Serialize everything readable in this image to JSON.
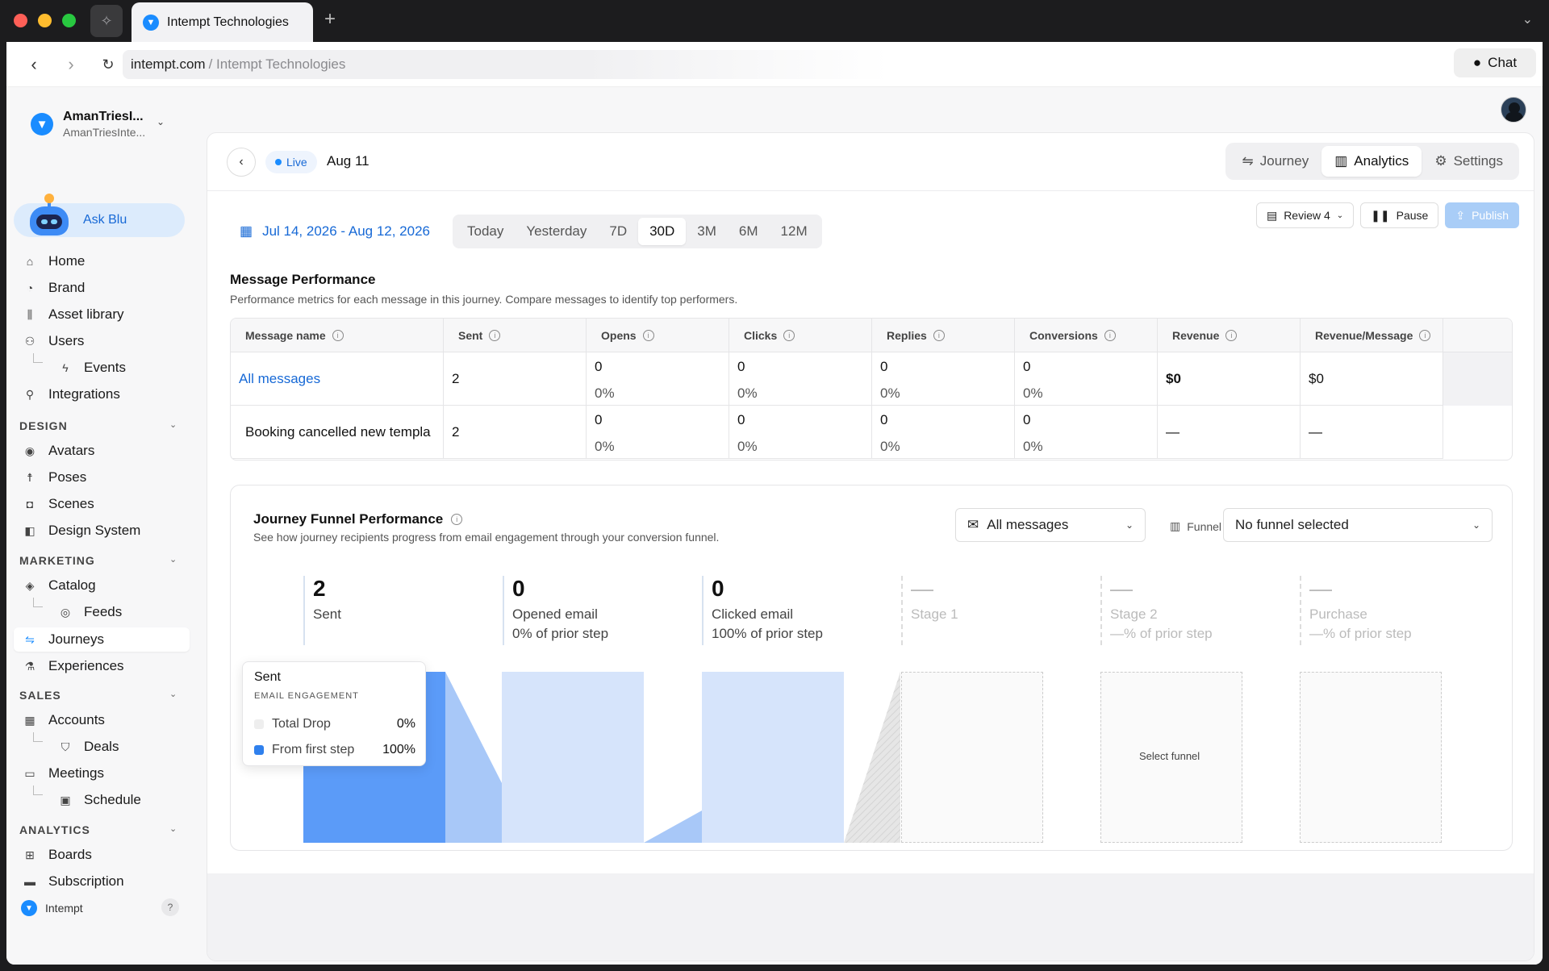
{
  "browser": {
    "tab_title": "Intempt Technologies",
    "url_domain": "intempt.com",
    "url_path": "/ Intempt Technologies",
    "chat_label": "Chat"
  },
  "sidebar": {
    "workspace_name": "AmanTriesI...",
    "workspace_sub": "AmanTriesInte...",
    "ask_blu": "Ask Blu",
    "items_top": [
      {
        "label": "Home",
        "icon": "home-icon"
      },
      {
        "label": "Brand",
        "icon": "palette-icon"
      },
      {
        "label": "Asset library",
        "icon": "library-icon"
      },
      {
        "label": "Users",
        "icon": "users-icon"
      }
    ],
    "events": "Events",
    "integrations": "Integrations",
    "sections": {
      "design": "DESIGN",
      "marketing": "MARKETING",
      "sales": "SALES",
      "analytics": "ANALYTICS"
    },
    "design_items": [
      "Avatars",
      "Poses",
      "Scenes",
      "Design System"
    ],
    "catalog": "Catalog",
    "feeds": "Feeds",
    "journeys": "Journeys",
    "experiences": "Experiences",
    "accounts": "Accounts",
    "deals": "Deals",
    "meetings": "Meetings",
    "schedule": "Schedule",
    "boards": "Boards",
    "subscription": "Subscription",
    "footer": "Intempt",
    "help": "?"
  },
  "header": {
    "status": "Live",
    "title": "Aug 11",
    "tabs": [
      "Journey",
      "Analytics",
      "Settings"
    ],
    "active_tab": "Analytics",
    "review_label": "Review 4",
    "pause_label": "Pause",
    "publish_label": "Publish"
  },
  "date_range": {
    "label": "Jul 14, 2026 - Aug 12, 2026",
    "options": [
      "Today",
      "Yesterday",
      "7D",
      "30D",
      "3M",
      "6M",
      "12M"
    ],
    "selected": "30D"
  },
  "message_performance": {
    "title": "Message Performance",
    "subtitle": "Performance metrics for each message in this journey. Compare messages to identify top performers.",
    "columns": [
      "Message name",
      "Sent",
      "Opens",
      "Clicks",
      "Replies",
      "Conversions",
      "Revenue",
      "Revenue/Message"
    ],
    "rows": [
      {
        "name": "All messages",
        "sent": "2",
        "opens": "0",
        "opens_pct": "0%",
        "clicks": "0",
        "clicks_pct": "0%",
        "replies": "0",
        "replies_pct": "0%",
        "conversions": "0",
        "conversions_pct": "0%",
        "revenue": "$0",
        "rpm": "$0"
      },
      {
        "name": "Booking cancelled new templa",
        "sent": "2",
        "opens": "0",
        "opens_pct": "0%",
        "clicks": "0",
        "clicks_pct": "0%",
        "replies": "0",
        "replies_pct": "0%",
        "conversions": "0",
        "conversions_pct": "0%",
        "revenue": "—",
        "rpm": "—"
      }
    ]
  },
  "funnel": {
    "title": "Journey Funnel Performance",
    "subtitle": "See how journey recipients progress from email engagement through your conversion funnel.",
    "messages_filter": "All messages",
    "funnel_label": "Funnel",
    "funnel_select": "No funnel selected",
    "stages": [
      {
        "value": "2",
        "label": "Sent",
        "sub": ""
      },
      {
        "value": "0",
        "label": "Opened email",
        "sub": "0% of prior step"
      },
      {
        "value": "0",
        "label": "Clicked email",
        "sub": "100% of prior step"
      },
      {
        "value": "—",
        "label": "Stage 1",
        "sub": ""
      },
      {
        "value": "—",
        "label": "Stage 2",
        "sub": "—% of prior step"
      },
      {
        "value": "—",
        "label": "Purchase",
        "sub": "—% of prior step"
      }
    ],
    "select_funnel": "Select funnel",
    "tooltip": {
      "title": "Sent",
      "subtitle": "EMAIL ENGAGEMENT",
      "rows": [
        {
          "label": "Total Drop",
          "value": "0%",
          "color": "#eeeeee"
        },
        {
          "label": "From first step",
          "value": "100%",
          "color": "#2f80ed"
        }
      ]
    },
    "colors": {
      "sent": "#5b9bf8",
      "drop": "#a8c8f8",
      "stage": "#d6e4fb"
    }
  }
}
